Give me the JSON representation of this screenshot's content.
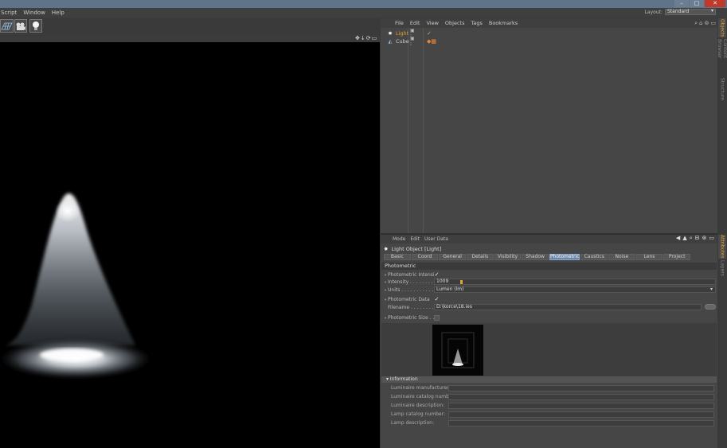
{
  "window": {
    "buttons": [
      "–",
      "□",
      "✕"
    ]
  },
  "menubar": {
    "items": [
      "Script",
      "Window",
      "Help"
    ],
    "layout_label": "Layout:",
    "layout_value": "Standard"
  },
  "object_manager": {
    "menu": [
      "File",
      "Edit",
      "View",
      "Objects",
      "Tags",
      "Bookmarks"
    ],
    "objects": [
      {
        "name": "Light"
      },
      {
        "name": "Cube"
      }
    ]
  },
  "side_tabs": [
    "Objects",
    "Content Browser",
    "Structure"
  ],
  "side_tabs_lower": [
    "Attributes",
    "Layers"
  ],
  "attributes": {
    "menu": [
      "Mode",
      "Edit",
      "User Data"
    ],
    "object_title": "Light Object [Light]",
    "tabs": [
      "Basic",
      "Coord",
      "General",
      "Details",
      "Visibility",
      "Shadow",
      "Photometric",
      "Caustics",
      "Noise",
      "Lens",
      "Project"
    ],
    "active_tab": "Photometric",
    "section": "Photometric",
    "props": {
      "photometric_intensity": {
        "label": "Photometric Intensity",
        "checked": "✓"
      },
      "intensity": {
        "label": "Intensity . . . . . . . . .",
        "value": "1009"
      },
      "units": {
        "label": "Units . . . . . . . . . . . .",
        "value": "Lumen (lm)"
      },
      "photometric_data": {
        "label": "Photometric Data",
        "checked": "✓"
      },
      "filename": {
        "label": "Filename . . . . . . . . .",
        "value": "D:\\korce\\18.ies"
      },
      "photometric_size": {
        "label": "Photometric Size . . . ."
      }
    },
    "information": {
      "header": "▾ Information",
      "fields": [
        "Luminaire manufacturer:",
        "Luminaire catalog number:",
        "Luminaire description:",
        "Lamp catalog number:",
        "Lamp description:"
      ]
    }
  }
}
